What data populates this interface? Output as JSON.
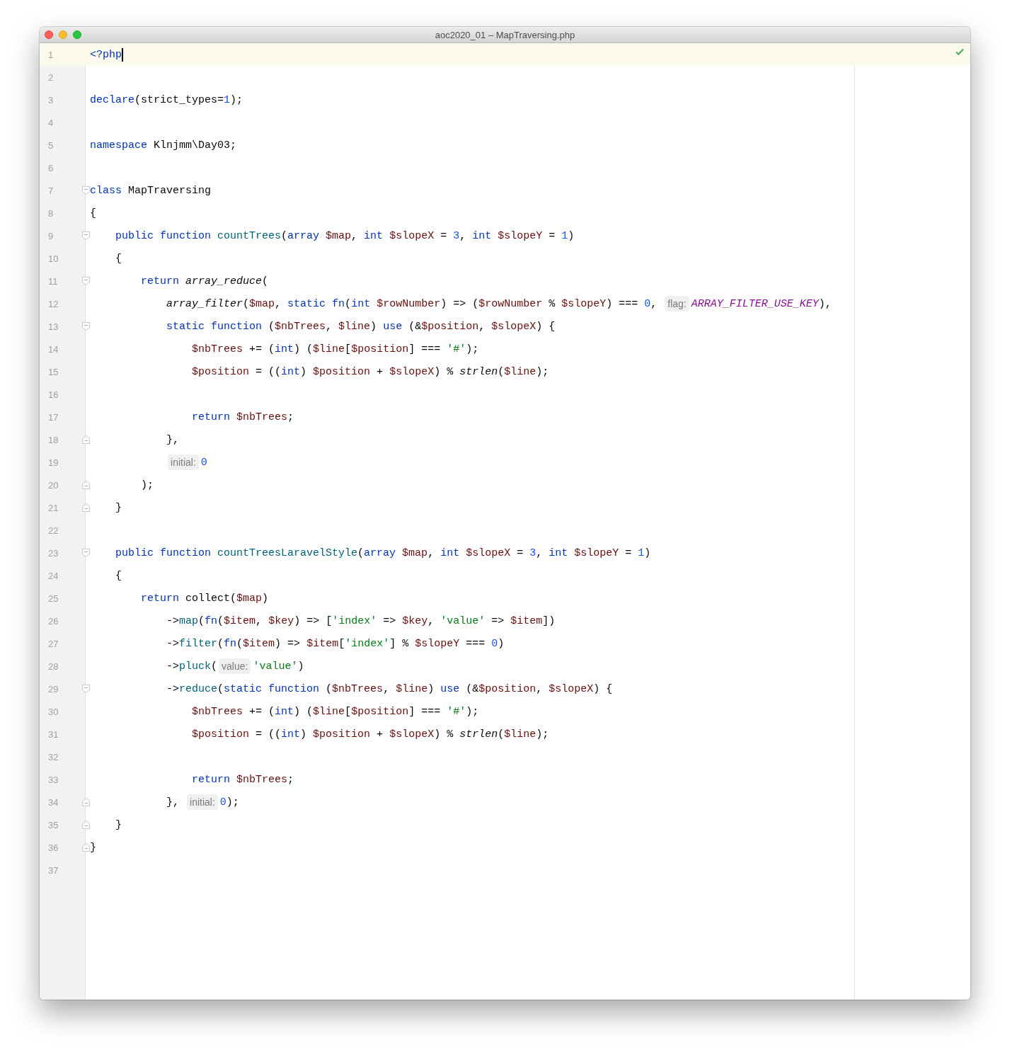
{
  "window": {
    "title": "aoc2020_01 – MapTraversing.php"
  },
  "status": {
    "kind": "ok"
  },
  "lines": [
    {
      "number": "1",
      "current": true,
      "caret": true,
      "tokens": [
        {
          "kind": "kw",
          "text": "<?php"
        }
      ]
    },
    {
      "number": "2"
    },
    {
      "number": "3",
      "tokens": [
        {
          "kind": "kw",
          "text": "declare"
        },
        {
          "kind": "plain",
          "text": "(strict_types="
        },
        {
          "kind": "num",
          "text": "1"
        },
        {
          "kind": "plain",
          "text": ");"
        }
      ]
    },
    {
      "number": "4"
    },
    {
      "number": "5",
      "tokens": [
        {
          "kind": "kw",
          "text": "namespace"
        },
        {
          "kind": "plain",
          "text": " Klnjmm\\Day03;"
        }
      ]
    },
    {
      "number": "6"
    },
    {
      "number": "7",
      "fold_open": true,
      "tokens": [
        {
          "kind": "kw",
          "text": "class"
        },
        {
          "kind": "plain",
          "text": " MapTraversing"
        }
      ]
    },
    {
      "number": "8",
      "tokens": [
        {
          "kind": "plain",
          "text": "{"
        }
      ]
    },
    {
      "number": "9",
      "fold_open": true,
      "tokens": [
        {
          "kind": "kw",
          "text": "    public function "
        },
        {
          "kind": "method",
          "text": "countTrees"
        },
        {
          "kind": "plain",
          "text": "("
        },
        {
          "kind": "kw",
          "text": "array "
        },
        {
          "kind": "var",
          "text": "$map"
        },
        {
          "kind": "plain",
          "text": ", "
        },
        {
          "kind": "kw",
          "text": "int "
        },
        {
          "kind": "var",
          "text": "$slopeX"
        },
        {
          "kind": "plain",
          "text": " = "
        },
        {
          "kind": "num",
          "text": "3"
        },
        {
          "kind": "plain",
          "text": ", "
        },
        {
          "kind": "kw",
          "text": "int "
        },
        {
          "kind": "var",
          "text": "$slopeY"
        },
        {
          "kind": "plain",
          "text": " = "
        },
        {
          "kind": "num",
          "text": "1"
        },
        {
          "kind": "plain",
          "text": ")"
        }
      ]
    },
    {
      "number": "10",
      "tokens": [
        {
          "kind": "plain",
          "text": "    {"
        }
      ]
    },
    {
      "number": "11",
      "fold_open": true,
      "tokens": [
        {
          "kind": "kw",
          "text": "        return "
        },
        {
          "kind": "fn",
          "text": "array_reduce"
        },
        {
          "kind": "plain",
          "text": "("
        }
      ]
    },
    {
      "number": "12",
      "tokens": [
        {
          "kind": "fn",
          "text": "            array_filter"
        },
        {
          "kind": "plain",
          "text": "("
        },
        {
          "kind": "var",
          "text": "$map"
        },
        {
          "kind": "plain",
          "text": ", "
        },
        {
          "kind": "kw",
          "text": "static fn"
        },
        {
          "kind": "plain",
          "text": "("
        },
        {
          "kind": "kw",
          "text": "int "
        },
        {
          "kind": "var",
          "text": "$rowNumber"
        },
        {
          "kind": "plain",
          "text": ") => ("
        },
        {
          "kind": "var",
          "text": "$rowNumber"
        },
        {
          "kind": "plain",
          "text": " % "
        },
        {
          "kind": "var",
          "text": "$slopeY"
        },
        {
          "kind": "plain",
          "text": ") === "
        },
        {
          "kind": "num",
          "text": "0"
        },
        {
          "kind": "plain",
          "text": ", "
        },
        {
          "kind": "hint",
          "text": "flag:"
        },
        {
          "kind": "const",
          "text": "ARRAY_FILTER_USE_KEY"
        },
        {
          "kind": "plain",
          "text": "),"
        }
      ]
    },
    {
      "number": "13",
      "fold_open": true,
      "tokens": [
        {
          "kind": "kw",
          "text": "            static function"
        },
        {
          "kind": "plain",
          "text": " ("
        },
        {
          "kind": "var",
          "text": "$nbTrees"
        },
        {
          "kind": "plain",
          "text": ", "
        },
        {
          "kind": "var",
          "text": "$line"
        },
        {
          "kind": "plain",
          "text": ") "
        },
        {
          "kind": "kw",
          "text": "use"
        },
        {
          "kind": "plain",
          "text": " (&"
        },
        {
          "kind": "var",
          "text": "$position"
        },
        {
          "kind": "plain",
          "text": ", "
        },
        {
          "kind": "var",
          "text": "$slopeX"
        },
        {
          "kind": "plain",
          "text": ") {"
        }
      ]
    },
    {
      "number": "14",
      "tokens": [
        {
          "kind": "var",
          "text": "                $nbTrees"
        },
        {
          "kind": "plain",
          "text": " += ("
        },
        {
          "kind": "kw",
          "text": "int"
        },
        {
          "kind": "plain",
          "text": ") ("
        },
        {
          "kind": "var",
          "text": "$line"
        },
        {
          "kind": "plain",
          "text": "["
        },
        {
          "kind": "var",
          "text": "$position"
        },
        {
          "kind": "plain",
          "text": "] === "
        },
        {
          "kind": "str",
          "text": "'#'"
        },
        {
          "kind": "plain",
          "text": ");"
        }
      ]
    },
    {
      "number": "15",
      "tokens": [
        {
          "kind": "var",
          "text": "                $position"
        },
        {
          "kind": "plain",
          "text": " = (("
        },
        {
          "kind": "kw",
          "text": "int"
        },
        {
          "kind": "plain",
          "text": ") "
        },
        {
          "kind": "var",
          "text": "$position"
        },
        {
          "kind": "plain",
          "text": " + "
        },
        {
          "kind": "var",
          "text": "$slopeX"
        },
        {
          "kind": "plain",
          "text": ") % "
        },
        {
          "kind": "fn",
          "text": "strlen"
        },
        {
          "kind": "plain",
          "text": "("
        },
        {
          "kind": "var",
          "text": "$line"
        },
        {
          "kind": "plain",
          "text": ");"
        }
      ]
    },
    {
      "number": "16"
    },
    {
      "number": "17",
      "tokens": [
        {
          "kind": "kw",
          "text": "                return "
        },
        {
          "kind": "var",
          "text": "$nbTrees"
        },
        {
          "kind": "plain",
          "text": ";"
        }
      ]
    },
    {
      "number": "18",
      "fold_close": true,
      "tokens": [
        {
          "kind": "plain",
          "text": "            },"
        }
      ]
    },
    {
      "number": "19",
      "tokens": [
        {
          "kind": "hint",
          "text": "initial:"
        },
        {
          "kind": "num",
          "text": "0"
        }
      ]
    },
    {
      "number": "20",
      "fold_close": true,
      "tokens": [
        {
          "kind": "plain",
          "text": "        );"
        }
      ]
    },
    {
      "number": "21",
      "fold_close": true,
      "tokens": [
        {
          "kind": "plain",
          "text": "    }"
        }
      ]
    },
    {
      "number": "22"
    },
    {
      "number": "23",
      "fold_open": true,
      "tokens": [
        {
          "kind": "kw",
          "text": "    public function "
        },
        {
          "kind": "method",
          "text": "countTreesLaravelStyle"
        },
        {
          "kind": "plain",
          "text": "("
        },
        {
          "kind": "kw",
          "text": "array "
        },
        {
          "kind": "var",
          "text": "$map"
        },
        {
          "kind": "plain",
          "text": ", "
        },
        {
          "kind": "kw",
          "text": "int "
        },
        {
          "kind": "var",
          "text": "$slopeX"
        },
        {
          "kind": "plain",
          "text": " = "
        },
        {
          "kind": "num",
          "text": "3"
        },
        {
          "kind": "plain",
          "text": ", "
        },
        {
          "kind": "kw",
          "text": "int "
        },
        {
          "kind": "var",
          "text": "$slopeY"
        },
        {
          "kind": "plain",
          "text": " = "
        },
        {
          "kind": "num",
          "text": "1"
        },
        {
          "kind": "plain",
          "text": ")"
        }
      ]
    },
    {
      "number": "24",
      "tokens": [
        {
          "kind": "plain",
          "text": "    {"
        }
      ]
    },
    {
      "number": "25",
      "tokens": [
        {
          "kind": "kw",
          "text": "        return"
        },
        {
          "kind": "plain",
          "text": " collect("
        },
        {
          "kind": "var",
          "text": "$map"
        },
        {
          "kind": "plain",
          "text": ")"
        }
      ]
    },
    {
      "number": "26",
      "tokens": [
        {
          "kind": "plain",
          "text": "            ->"
        },
        {
          "kind": "method",
          "text": "map"
        },
        {
          "kind": "plain",
          "text": "("
        },
        {
          "kind": "kw",
          "text": "fn"
        },
        {
          "kind": "plain",
          "text": "("
        },
        {
          "kind": "var",
          "text": "$item"
        },
        {
          "kind": "plain",
          "text": ", "
        },
        {
          "kind": "var",
          "text": "$key"
        },
        {
          "kind": "plain",
          "text": ") => ["
        },
        {
          "kind": "str",
          "text": "'index'"
        },
        {
          "kind": "plain",
          "text": " => "
        },
        {
          "kind": "var",
          "text": "$key"
        },
        {
          "kind": "plain",
          "text": ", "
        },
        {
          "kind": "str",
          "text": "'value'"
        },
        {
          "kind": "plain",
          "text": " => "
        },
        {
          "kind": "var",
          "text": "$item"
        },
        {
          "kind": "plain",
          "text": "])"
        }
      ]
    },
    {
      "number": "27",
      "tokens": [
        {
          "kind": "plain",
          "text": "            ->"
        },
        {
          "kind": "method",
          "text": "filter"
        },
        {
          "kind": "plain",
          "text": "("
        },
        {
          "kind": "kw",
          "text": "fn"
        },
        {
          "kind": "plain",
          "text": "("
        },
        {
          "kind": "var",
          "text": "$item"
        },
        {
          "kind": "plain",
          "text": ") => "
        },
        {
          "kind": "var",
          "text": "$item"
        },
        {
          "kind": "plain",
          "text": "["
        },
        {
          "kind": "str",
          "text": "'index'"
        },
        {
          "kind": "plain",
          "text": "] % "
        },
        {
          "kind": "var",
          "text": "$slopeY"
        },
        {
          "kind": "plain",
          "text": " === "
        },
        {
          "kind": "num",
          "text": "0"
        },
        {
          "kind": "plain",
          "text": ")"
        }
      ]
    },
    {
      "number": "28",
      "tokens": [
        {
          "kind": "plain",
          "text": "            ->"
        },
        {
          "kind": "method",
          "text": "pluck"
        },
        {
          "kind": "plain",
          "text": "("
        },
        {
          "kind": "hint",
          "text": "value:"
        },
        {
          "kind": "str",
          "text": "'value'"
        },
        {
          "kind": "plain",
          "text": ")"
        }
      ]
    },
    {
      "number": "29",
      "fold_open": true,
      "tokens": [
        {
          "kind": "plain",
          "text": "            ->"
        },
        {
          "kind": "method",
          "text": "reduce"
        },
        {
          "kind": "plain",
          "text": "("
        },
        {
          "kind": "kw",
          "text": "static function"
        },
        {
          "kind": "plain",
          "text": " ("
        },
        {
          "kind": "var",
          "text": "$nbTrees"
        },
        {
          "kind": "plain",
          "text": ", "
        },
        {
          "kind": "var",
          "text": "$line"
        },
        {
          "kind": "plain",
          "text": ") "
        },
        {
          "kind": "kw",
          "text": "use"
        },
        {
          "kind": "plain",
          "text": " (&"
        },
        {
          "kind": "var",
          "text": "$position"
        },
        {
          "kind": "plain",
          "text": ", "
        },
        {
          "kind": "var",
          "text": "$slopeX"
        },
        {
          "kind": "plain",
          "text": ") {"
        }
      ]
    },
    {
      "number": "30",
      "tokens": [
        {
          "kind": "var",
          "text": "                $nbTrees"
        },
        {
          "kind": "plain",
          "text": " += ("
        },
        {
          "kind": "kw",
          "text": "int"
        },
        {
          "kind": "plain",
          "text": ") ("
        },
        {
          "kind": "var",
          "text": "$line"
        },
        {
          "kind": "plain",
          "text": "["
        },
        {
          "kind": "var",
          "text": "$position"
        },
        {
          "kind": "plain",
          "text": "] === "
        },
        {
          "kind": "str",
          "text": "'#'"
        },
        {
          "kind": "plain",
          "text": ");"
        }
      ]
    },
    {
      "number": "31",
      "tokens": [
        {
          "kind": "var",
          "text": "                $position"
        },
        {
          "kind": "plain",
          "text": " = (("
        },
        {
          "kind": "kw",
          "text": "int"
        },
        {
          "kind": "plain",
          "text": ") "
        },
        {
          "kind": "var",
          "text": "$position"
        },
        {
          "kind": "plain",
          "text": " + "
        },
        {
          "kind": "var",
          "text": "$slopeX"
        },
        {
          "kind": "plain",
          "text": ") % "
        },
        {
          "kind": "fn",
          "text": "strlen"
        },
        {
          "kind": "plain",
          "text": "("
        },
        {
          "kind": "var",
          "text": "$line"
        },
        {
          "kind": "plain",
          "text": ");"
        }
      ]
    },
    {
      "number": "32"
    },
    {
      "number": "33",
      "tokens": [
        {
          "kind": "kw",
          "text": "                return "
        },
        {
          "kind": "var",
          "text": "$nbTrees"
        },
        {
          "kind": "plain",
          "text": ";"
        }
      ]
    },
    {
      "number": "34",
      "fold_close": true,
      "tokens": [
        {
          "kind": "plain",
          "text": "            }, "
        },
        {
          "kind": "hint",
          "text": "initial:"
        },
        {
          "kind": "num",
          "text": "0"
        },
        {
          "kind": "plain",
          "text": ");"
        }
      ]
    },
    {
      "number": "35",
      "fold_close": true,
      "tokens": [
        {
          "kind": "plain",
          "text": "    }"
        }
      ]
    },
    {
      "number": "36",
      "fold_close": true,
      "tokens": [
        {
          "kind": "plain",
          "text": "}"
        }
      ]
    },
    {
      "number": "37"
    }
  ]
}
